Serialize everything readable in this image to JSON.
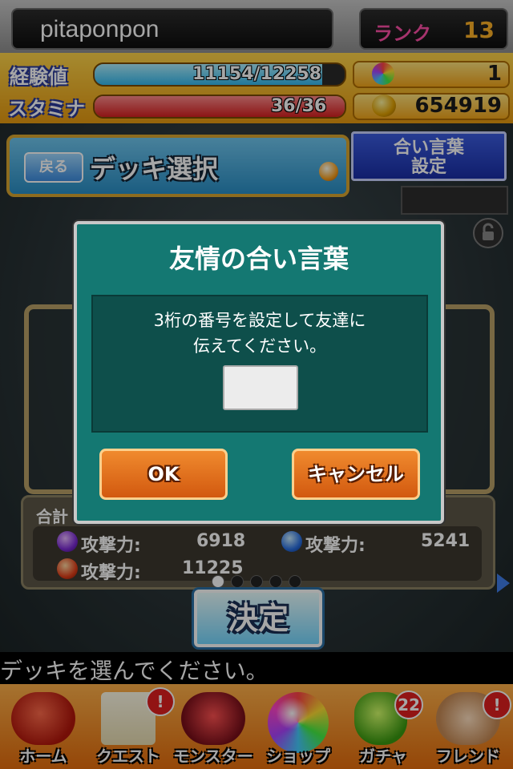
{
  "header": {
    "username": "pitaponpon",
    "rank_label": "ランク",
    "rank_value": "13"
  },
  "stats": {
    "exp_label": "経験値",
    "exp_text": "11154/12258",
    "exp_fraction": 0.91,
    "stamina_label": "スタミナ",
    "stamina_text": "36/36",
    "stamina_fraction": 1.0,
    "orb_count": "1",
    "coins": "654919"
  },
  "deck": {
    "back_label": "戻る",
    "title": "デッキ選択",
    "password_button": [
      "合い言葉",
      "設定"
    ],
    "total_label": "合計",
    "attack_label": "攻撃力:",
    "attacks": [
      {
        "orb": "dark",
        "value": "6918"
      },
      {
        "orb": "water",
        "value": "5241"
      },
      {
        "orb": "fire",
        "value": "11225"
      }
    ],
    "decide_label": "決定",
    "page_dots": 5
  },
  "message": "デッキを選んでください。",
  "nav": {
    "items": [
      {
        "label": "ホーム",
        "icon": "home-dragon-icon"
      },
      {
        "label": "クエスト",
        "icon": "quest-scroll-icon",
        "badge": "!"
      },
      {
        "label": "モンスター",
        "icon": "monster-dragon-icon"
      },
      {
        "label": "ショップ",
        "icon": "rainbow-orb-icon"
      },
      {
        "label": "ガチャ",
        "icon": "gacha-egg-icon",
        "badge": "22"
      },
      {
        "label": "フレンド",
        "icon": "handshake-icon",
        "badge": "!"
      }
    ]
  },
  "dialog": {
    "title": "友情の合い言葉",
    "line1": "3桁の番号を設定して友達に",
    "line2": "伝えてください。",
    "input_value": "",
    "ok_label": "OK",
    "cancel_label": "キャンセル"
  },
  "colors": {
    "dialog_bg": "#147872",
    "stat_band": "#f3b32a",
    "nav_band": "#f08a2e"
  }
}
